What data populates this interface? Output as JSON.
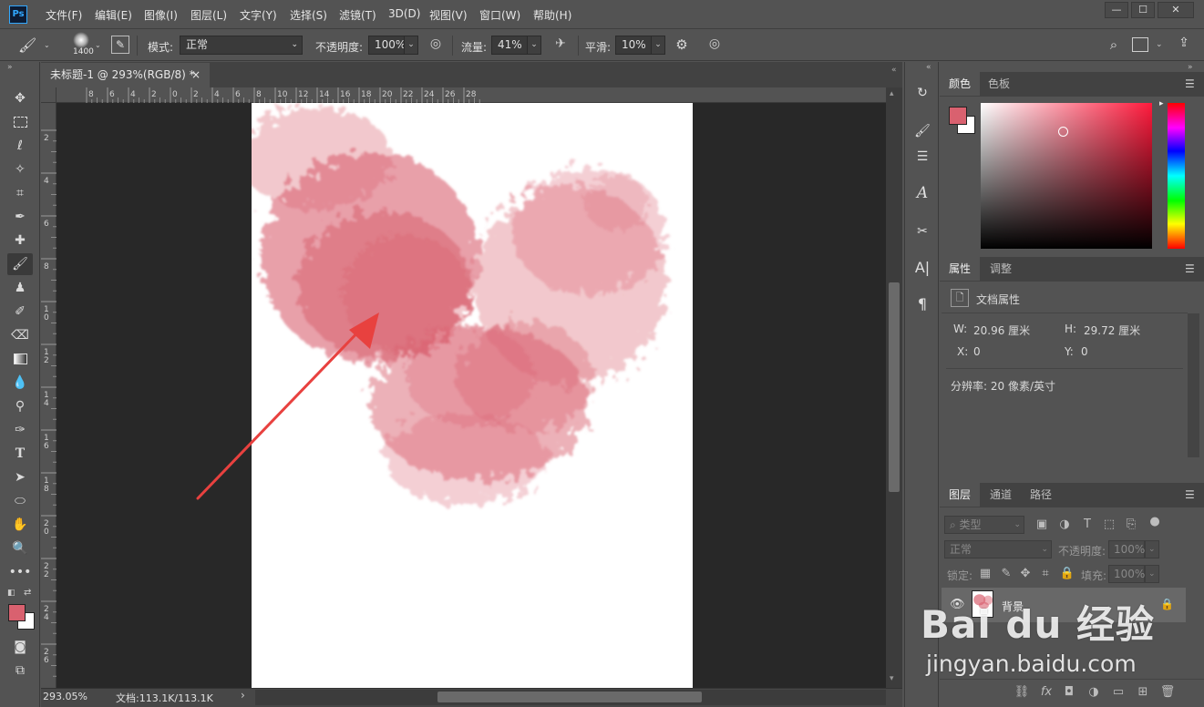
{
  "app": {
    "logo": "Ps"
  },
  "menus": [
    "文件(F)",
    "编辑(E)",
    "图像(I)",
    "图层(L)",
    "文字(Y)",
    "选择(S)",
    "滤镜(T)",
    "3D(D)",
    "视图(V)",
    "窗口(W)",
    "帮助(H)"
  ],
  "window_controls": {
    "minimize": "—",
    "maximize": "☐",
    "close": "✕"
  },
  "options": {
    "brush_size": "1400",
    "mode_label": "模式:",
    "mode_value": "正常",
    "opacity_label": "不透明度:",
    "opacity_value": "100%",
    "flow_label": "流量:",
    "flow_value": "41%",
    "smoothing_label": "平滑:",
    "smoothing_value": "10%"
  },
  "document_tab": {
    "title": "未标题-1 @ 293%(RGB/8) *",
    "close": "×"
  },
  "ruler_top_labels": [
    "8",
    "6",
    "4",
    "2",
    "0",
    "2",
    "4",
    "6",
    "8",
    "10",
    "12",
    "14",
    "16",
    "18",
    "20",
    "22",
    "24",
    "26",
    "28"
  ],
  "ruler_left_labels": [
    "2",
    "4",
    "6",
    "8",
    "1 0",
    "1 2",
    "1 4",
    "1 6",
    "1 8",
    "2 0",
    "2 2",
    "2 4",
    "2 6"
  ],
  "status": {
    "zoom": "293.05%",
    "doc_info": "文档:113.1K/113.1K",
    "arrow": "›"
  },
  "color_panel": {
    "tabs": [
      "颜色",
      "色板"
    ],
    "foreground": "#d9616f",
    "background": "#ffffff"
  },
  "properties_panel": {
    "tabs": [
      "属性",
      "调整"
    ],
    "title": "文档属性",
    "w_label": "W:",
    "w_value": "20.96 厘米",
    "h_label": "H:",
    "h_value": "29.72 厘米",
    "x_label": "X:",
    "x_value": "0",
    "y_label": "Y:",
    "y_value": "0",
    "resolution": "分辨率: 20 像素/英寸"
  },
  "layers_panel": {
    "tabs": [
      "图层",
      "通道",
      "路径"
    ],
    "filter_placeholder": "类型",
    "blend_mode": "正常",
    "opacity_label": "不透明度:",
    "opacity_value": "100%",
    "lock_label": "锁定:",
    "fill_label": "填充:",
    "fill_value": "100%",
    "layer_name": "背景"
  },
  "watermark": {
    "brand": "Bai du 经验",
    "url": "jingyan.baidu.com"
  },
  "colors": {
    "paint": "#d9616f",
    "arrow": "#e8413f",
    "ui_bg": "#535353",
    "pasteboard": "#282828"
  }
}
